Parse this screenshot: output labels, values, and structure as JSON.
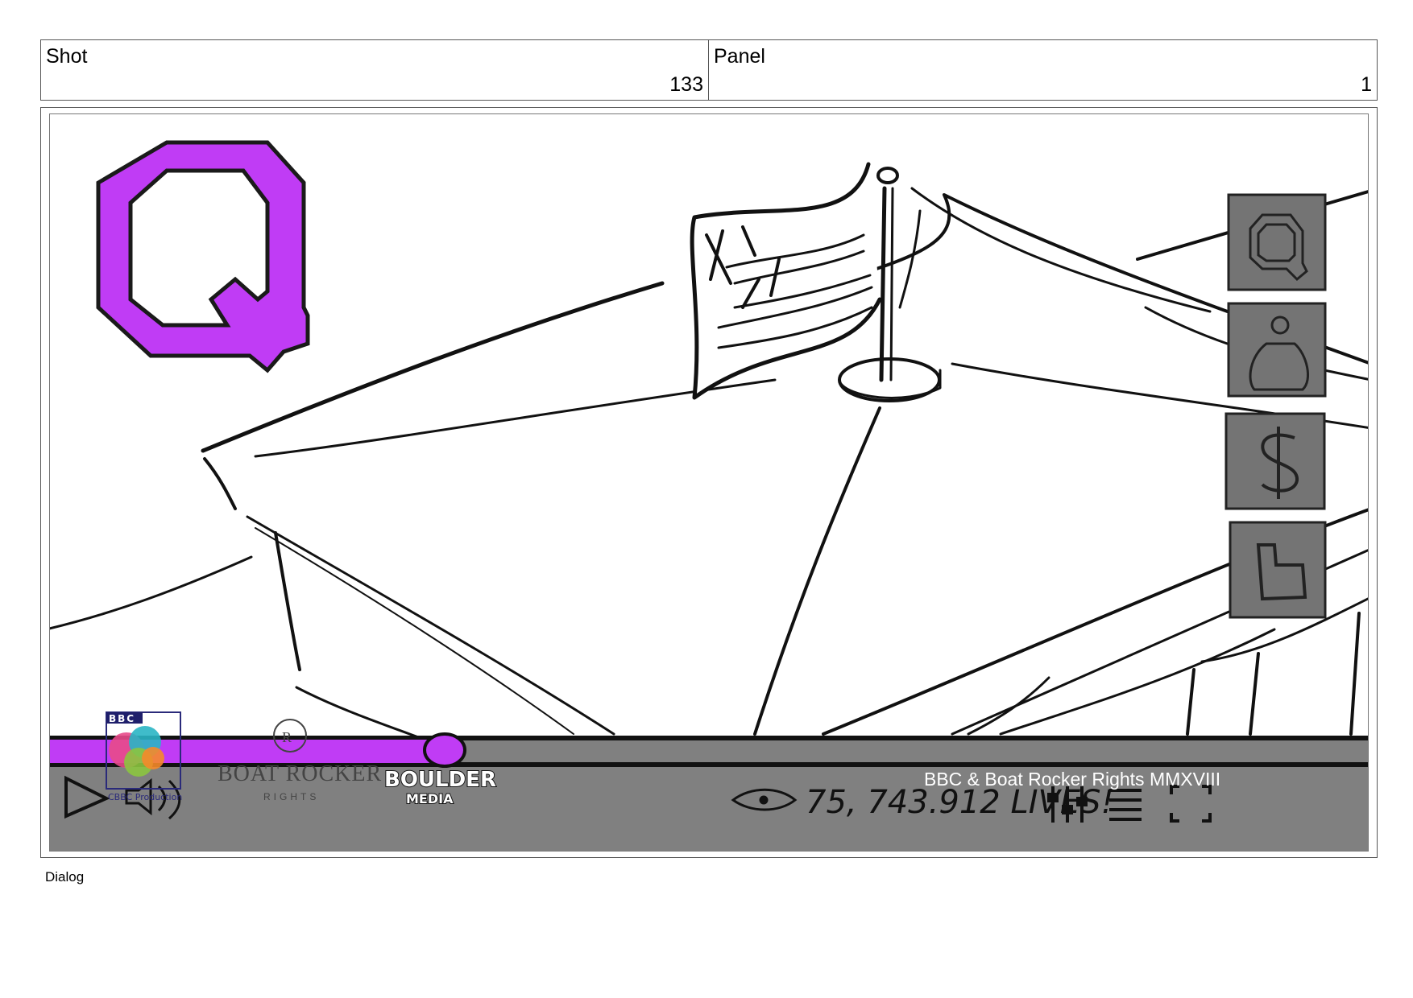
{
  "header": {
    "shot_label": "Shot",
    "shot_value": "133",
    "panel_label": "Panel",
    "panel_value": "1"
  },
  "frame": {
    "big_letter": "Q",
    "accent_color": "#c03cf5",
    "bar_color": "#808080",
    "side_buttons": [
      {
        "icon": "q-icon"
      },
      {
        "icon": "person-icon"
      },
      {
        "icon": "dollar-icon"
      },
      {
        "icon": "thumbs-up-icon"
      }
    ],
    "progress": 0.3,
    "views_text": "75, 743.912 LIVES!",
    "copyright": "BBC & Boat Rocker Rights MMXVIII",
    "logos": {
      "bbc": "BBC",
      "cbbc_production": "CBBC Production",
      "boat_rocker": "BOAT ROCKER",
      "boat_rocker_sub": "RIGHTS",
      "boulder_line1": "BOULDER",
      "boulder_line2": "MEDIA"
    }
  },
  "dialog_label": "Dialog"
}
